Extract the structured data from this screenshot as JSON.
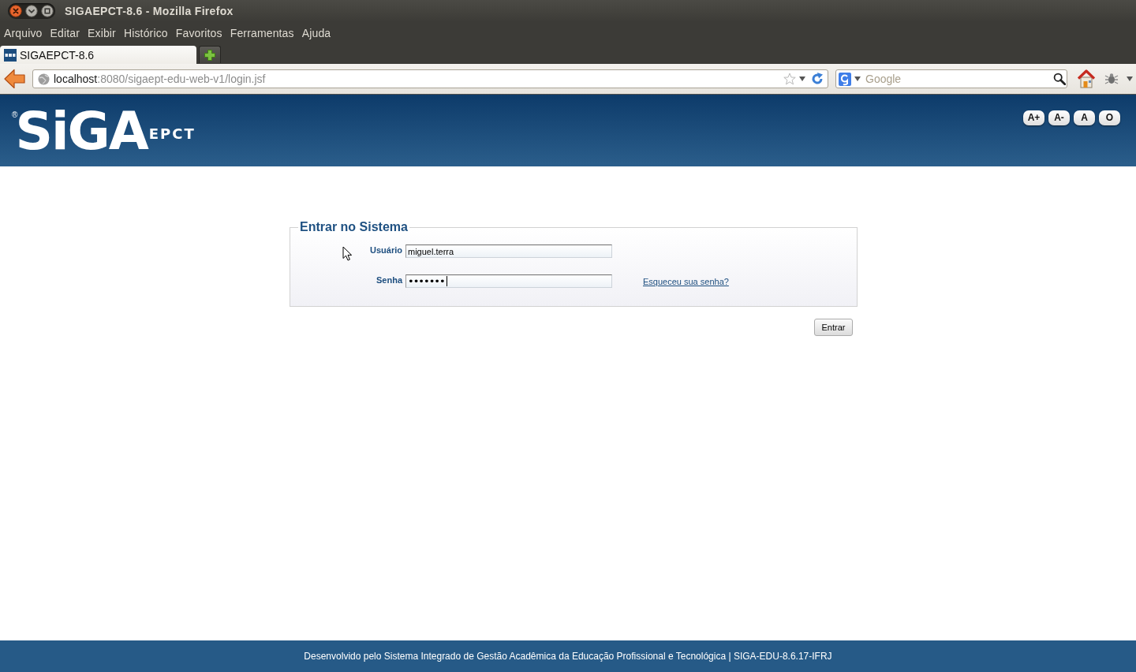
{
  "window": {
    "title": "SIGAEPCT-8.6 - Mozilla Firefox"
  },
  "menu_bar": [
    "Arquivo",
    "Editar",
    "Exibir",
    "Histórico",
    "Favoritos",
    "Ferramentas",
    "Ajuda"
  ],
  "tabs": [
    {
      "title": "SIGAEPCT-8.6",
      "selected": true
    }
  ],
  "address_bar": {
    "host": "localhost",
    "path": ":8080/sigaept-edu-web-v1/login.jsf"
  },
  "search_field": {
    "placeholder": "Google"
  },
  "header": {
    "logo": {
      "mark": "®",
      "name": "SiGA",
      "suffix": "EPCT"
    },
    "accessibility_buttons": [
      "A+",
      "A-",
      "A",
      "O"
    ]
  },
  "login": {
    "legend": "Entrar no Sistema",
    "fields": [
      {
        "kind": "text",
        "label": "Usuário",
        "value": "miguel.terra",
        "focused": false
      },
      {
        "kind": "password",
        "label": "Senha",
        "value": "•••••••",
        "focused": true,
        "link": "Esqueceu sua senha?"
      }
    ],
    "submit": "Entrar"
  },
  "footer": {
    "text": "Desenvolvido pelo Sistema Integrado de Gestão Acadêmica da Educação Profissional e Tecnológica | SIGA-EDU-8.6.17-IFRJ"
  }
}
